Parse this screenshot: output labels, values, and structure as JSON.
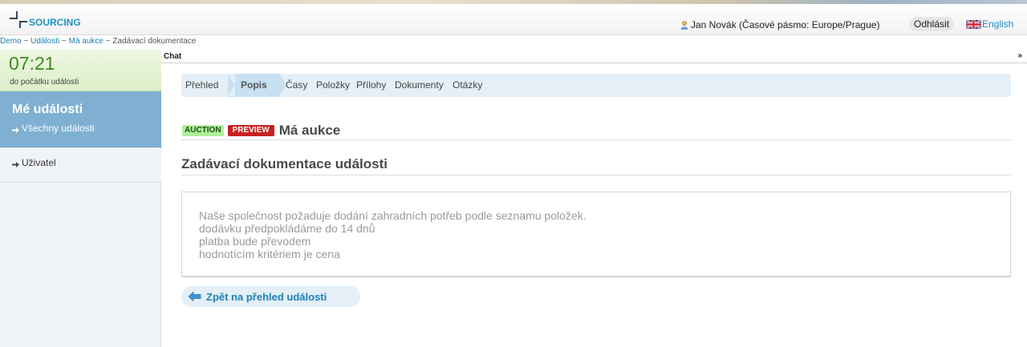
{
  "header": {
    "logo_text": "SOURCING",
    "user_text": "Jan Novák (Časové pásmo: Europe/Prague)",
    "logout_label": "Odhlásit",
    "language_label": "English"
  },
  "breadcrumb": {
    "items": [
      "Demo",
      "Události",
      "Má aukce"
    ],
    "separator": " ~ ",
    "current": "Zadávací dokumentace"
  },
  "sidebar": {
    "timer": {
      "time": "07:21",
      "label": "do počátku události"
    },
    "events_title": "Mé události",
    "events_link": "Všechny události",
    "user_link": "Uživatel"
  },
  "chat": {
    "label": "Chat",
    "toggle": "»"
  },
  "tabs": [
    {
      "label": "Přehled",
      "active": false
    },
    {
      "label": "Popis",
      "active": true
    },
    {
      "label": "Časy",
      "active": false
    },
    {
      "label": "Položky",
      "active": false
    },
    {
      "label": "Přílohy",
      "active": false
    },
    {
      "label": "Dokumenty",
      "active": false
    },
    {
      "label": "Otázky",
      "active": false
    }
  ],
  "event": {
    "badge_auction": "AUCTION",
    "badge_preview": "PREVIEW",
    "name": "Má aukce"
  },
  "section_title": "Zadávací dokumentace události",
  "document_lines": [
    "Naše společnost požaduje dodání zahradních potřeb podle seznamu položek.",
    "dodávku předpokládáme do 14 dnů",
    "platba bude převodem",
    "hodnotícím kritériem je cena"
  ],
  "back_button_label": "Zpět na přehled události",
  "colors": {
    "accent_blue": "#1e7fb5",
    "timer_green": "#3d8a1f",
    "sidebar_active": "#7fb0d2",
    "preview_red": "#c81f1f",
    "auction_green": "#aef09a"
  }
}
